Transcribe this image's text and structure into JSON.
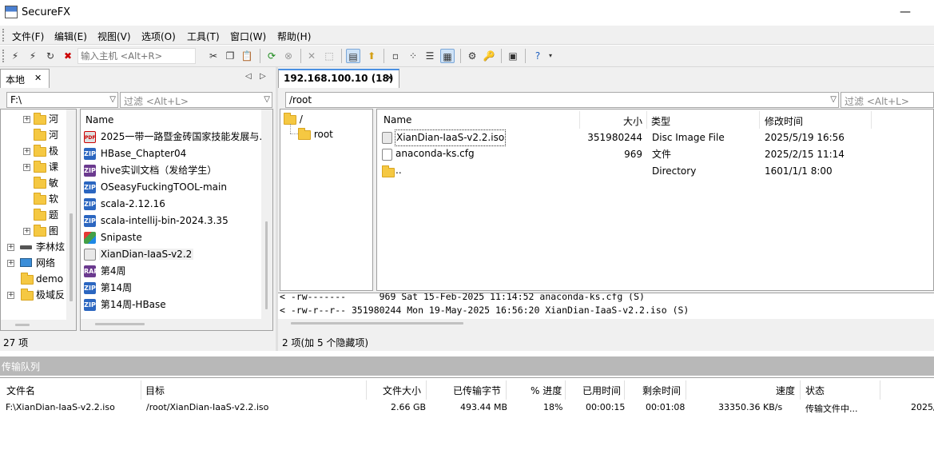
{
  "app": {
    "title": "SecureFX",
    "minimize": "—"
  },
  "menu": [
    "文件(F)",
    "编辑(E)",
    "视图(V)",
    "选项(O)",
    "工具(T)",
    "窗口(W)",
    "帮助(H)"
  ],
  "toolbar": {
    "connect_placeholder": "输入主机 <Alt+R>"
  },
  "local": {
    "tab_label": "本地",
    "tab_close": "✕",
    "path": "F:\\",
    "filter_placeholder": "过滤 <Alt+L>",
    "tree": [
      {
        "label": "河",
        "type": "folder",
        "expand": true
      },
      {
        "label": "河",
        "type": "folder",
        "expand": false
      },
      {
        "label": "极",
        "type": "folder",
        "expand": true
      },
      {
        "label": "课",
        "type": "folder",
        "expand": true
      },
      {
        "label": "敏",
        "type": "folder",
        "expand": false
      },
      {
        "label": "软",
        "type": "folder",
        "expand": false
      },
      {
        "label": "题",
        "type": "folder",
        "expand": false
      },
      {
        "label": "图",
        "type": "folder",
        "expand": true
      },
      {
        "label": "李林炫",
        "type": "drive",
        "expand": true
      },
      {
        "label": "网络",
        "type": "network",
        "expand": true
      },
      {
        "label": "demo",
        "type": "folder",
        "expand": false
      },
      {
        "label": "极域反",
        "type": "folder",
        "expand": true
      }
    ],
    "list_header": "Name",
    "files": [
      {
        "name": "2025一带一路暨金砖国家技能发展与..",
        "icon": "pdf",
        "icon_text": "PDF"
      },
      {
        "name": "HBase_Chapter04",
        "icon": "zip",
        "icon_text": "ZIP"
      },
      {
        "name": "hive实训文档（发给学生）",
        "icon": "rar",
        "icon_text": "ZIP"
      },
      {
        "name": "OSeasyFuckingTOOL-main",
        "icon": "zip",
        "icon_text": "ZIP"
      },
      {
        "name": "scala-2.12.16",
        "icon": "zip",
        "icon_text": "ZIP"
      },
      {
        "name": "scala-intellij-bin-2024.3.35",
        "icon": "zip",
        "icon_text": "ZIP"
      },
      {
        "name": "Snipaste",
        "icon": "snip",
        "icon_text": ""
      },
      {
        "name": "XianDian-IaaS-v2.2",
        "icon": "iso",
        "icon_text": ""
      },
      {
        "name": "第4周",
        "icon": "rar",
        "icon_text": "RAR"
      },
      {
        "name": "第14周",
        "icon": "zip",
        "icon_text": "ZIP"
      },
      {
        "name": "第14周-HBase",
        "icon": "zip",
        "icon_text": "ZIP"
      }
    ],
    "status": "27 项"
  },
  "remote": {
    "tab_label": "192.168.100.10 (18)",
    "tab_close": "✕",
    "path": "/root",
    "filter_placeholder": "过滤 <Alt+L>",
    "tree": [
      {
        "label": "/"
      },
      {
        "label": "root"
      }
    ],
    "columns": [
      "Name",
      "大小",
      "类型",
      "修改时间"
    ],
    "files": [
      {
        "name": "XianDian-IaaS-v2.2.iso",
        "size": "351980244",
        "type": "Disc Image File",
        "modified": "2025/5/19 16:56",
        "icon": "iso"
      },
      {
        "name": "anaconda-ks.cfg",
        "size": "969",
        "type": "文件",
        "modified": "2025/2/15 11:14",
        "icon": "cfg"
      },
      {
        "name": "..",
        "size": "",
        "type": "Directory",
        "modified": "1601/1/1 8:00",
        "icon": "folder"
      }
    ],
    "log": [
      "< -rw-------      969 Sat 15-Feb-2025 11:14:52 anaconda-ks.cfg (S)",
      "< -rw-r--r-- 351980244 Mon 19-May-2025 16:56:20 XianDian-IaaS-v2.2.iso (S)"
    ],
    "status": "2 项(加 5 个隐藏项)"
  },
  "queue": {
    "title": "传输队列",
    "columns": [
      "文件名",
      "目标",
      "文件大小",
      "已传输字节",
      "% 进度",
      "已用时间",
      "剩余时间",
      "速度",
      "状态"
    ],
    "rows": [
      {
        "file": "F:\\XianDian-IaaS-v2.2.iso",
        "target": "/root/XianDian-IaaS-v2.2.iso",
        "size": "2.66 GB",
        "transferred": "493.44 MB",
        "progress": "18%",
        "elapsed": "00:00:15",
        "remaining": "00:01:08",
        "speed": "33350.36 KB/s",
        "status": "传输文件中...",
        "extra": "2025/"
      }
    ]
  }
}
